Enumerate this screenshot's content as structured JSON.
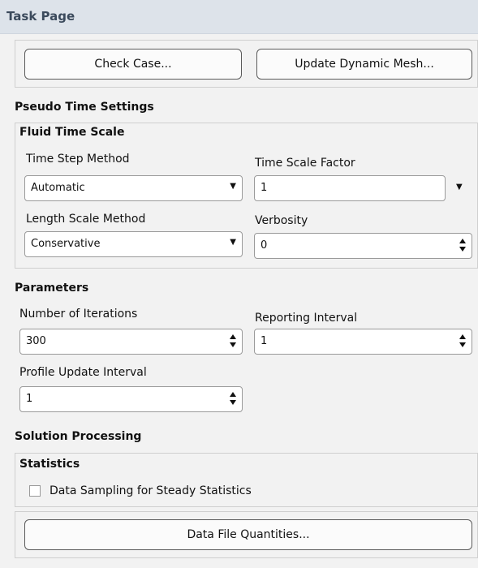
{
  "header": {
    "title": "Task Page"
  },
  "top_buttons": {
    "check_case": "Check Case...",
    "update_mesh": "Update Dynamic Mesh..."
  },
  "pseudo_time": {
    "section_title": "Pseudo Time Settings",
    "fluid_title": "Fluid Time Scale",
    "time_step_method": {
      "label": "Time Step Method",
      "value": "Automatic"
    },
    "time_scale_factor": {
      "label": "Time Scale Factor",
      "value": "1"
    },
    "length_scale_method": {
      "label": "Length Scale Method",
      "value": "Conservative"
    },
    "verbosity": {
      "label": "Verbosity",
      "value": "0"
    }
  },
  "parameters": {
    "section_title": "Parameters",
    "iterations": {
      "label": "Number of Iterations",
      "value": "300"
    },
    "reporting": {
      "label": "Reporting Interval",
      "value": "1"
    },
    "profile": {
      "label": "Profile Update Interval",
      "value": "1"
    }
  },
  "solution": {
    "section_title": "Solution Processing",
    "statistics_title": "Statistics",
    "sampling_label": "Data Sampling for Steady Statistics",
    "sampling_checked": false,
    "data_file_button": "Data File Quantities..."
  }
}
